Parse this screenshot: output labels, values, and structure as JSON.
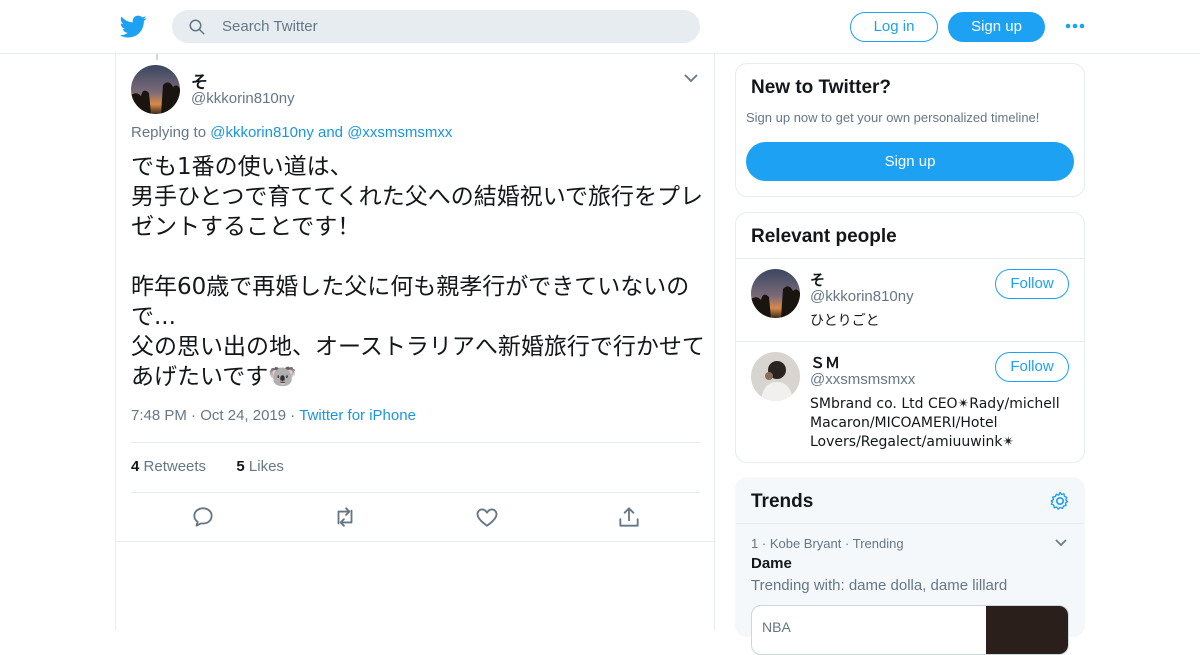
{
  "nav": {
    "search_placeholder": "Search Twitter",
    "login_label": "Log in",
    "signup_label": "Sign up",
    "brand_color": "#1da1f2",
    "logo_icon": "twitter-bird-icon",
    "more_icon": "more-dots-icon"
  },
  "tweet": {
    "author_name": "そ",
    "author_handle": "@kkkorin810ny",
    "replying_prefix": "Replying to",
    "replying_to_1": "@kkkorin810ny",
    "replying_and": "and",
    "replying_to_2": "@xxsmsmsmxx",
    "text": "でも1番の使い道は、\n男手ひとつで育ててくれた父への結婚祝いで旅行をプレゼントすることです！\n\n昨年60歳で再婚した父に何も親孝行ができていないので...\n父の思い出の地、オーストラリアへ新婚旅行で行かせてあげたいです🐨",
    "time": "7:48 PM",
    "date": "Oct 24, 2019",
    "source": "Twitter for iPhone",
    "retweet_count": "4",
    "retweet_label": "Retweets",
    "like_count": "5",
    "like_label": "Likes",
    "actions": [
      "reply-icon",
      "retweet-icon",
      "like-icon",
      "share-icon"
    ]
  },
  "sidebar": {
    "new_title": "New to Twitter?",
    "new_subtitle": "Sign up now to get your own personalized timeline!",
    "new_signup_label": "Sign up",
    "people_title": "Relevant people",
    "people": [
      {
        "name": "そ",
        "handle": "@kkkorin810ny",
        "bio": "ひとりごと",
        "follow_label": "Follow"
      },
      {
        "name": "ＳＭ",
        "handle": "@xxsmsmsmxx",
        "bio": "SMbrand co. Ltd CEO✴Rady/michell Macaron/MICOAMERI/Hotel Lovers/Regalect/amiuuwink✴",
        "follow_label": "Follow"
      }
    ],
    "trends_title": "Trends",
    "trend": {
      "rank": "1",
      "context": "Kobe Bryant",
      "status": "Trending",
      "name": "Dame",
      "with": "Trending with: dame dolla, dame lillard",
      "card_label": "NBA"
    }
  }
}
